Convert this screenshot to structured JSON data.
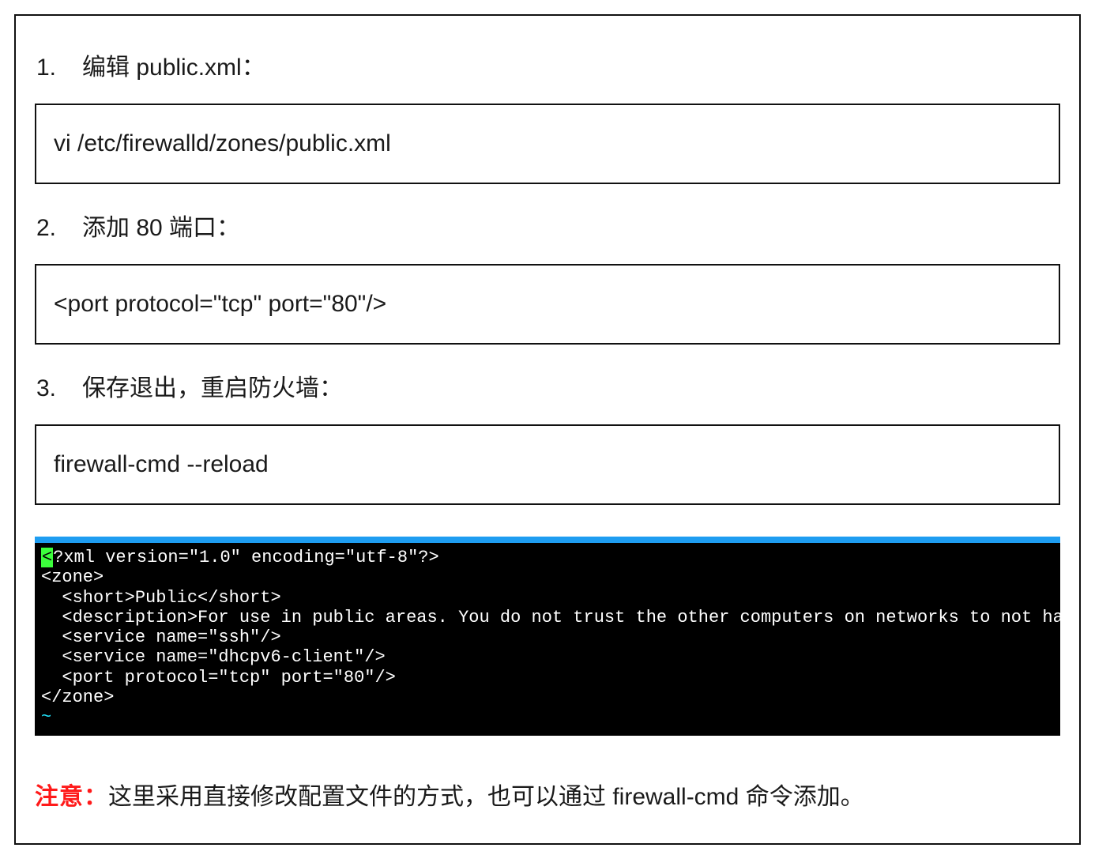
{
  "steps": [
    {
      "num": "1.",
      "text": "编辑 public.xml："
    },
    {
      "num": "2.",
      "text": "添加 80 端口："
    },
    {
      "num": "3.",
      "text": "保存退出，重启防火墙："
    }
  ],
  "code": {
    "block1": "vi /etc/firewalld/zones/public.xml",
    "block2": "<port protocol=\"tcp\" port=\"80\"/>",
    "block3": "firewall-cmd --reload"
  },
  "terminal": {
    "cursor_char": "<",
    "line1_after_cursor": "?xml version=\"1.0\" encoding=\"utf-8\"?>",
    "line2": "<zone>",
    "line3": "  <short>Public</short>",
    "line4": "  <description>For use in public areas. You do not trust the other computers on networks to not harm y",
    "line5": "  <service name=\"ssh\"/>",
    "line6": "  <service name=\"dhcpv6-client\"/>",
    "line7": "  <port protocol=\"tcp\" port=\"80\"/>",
    "line8": "</zone>",
    "tilde": "~"
  },
  "note": {
    "label": "注意：",
    "text": "这里采用直接修改配置文件的方式，也可以通过 firewall-cmd 命令添加。"
  }
}
